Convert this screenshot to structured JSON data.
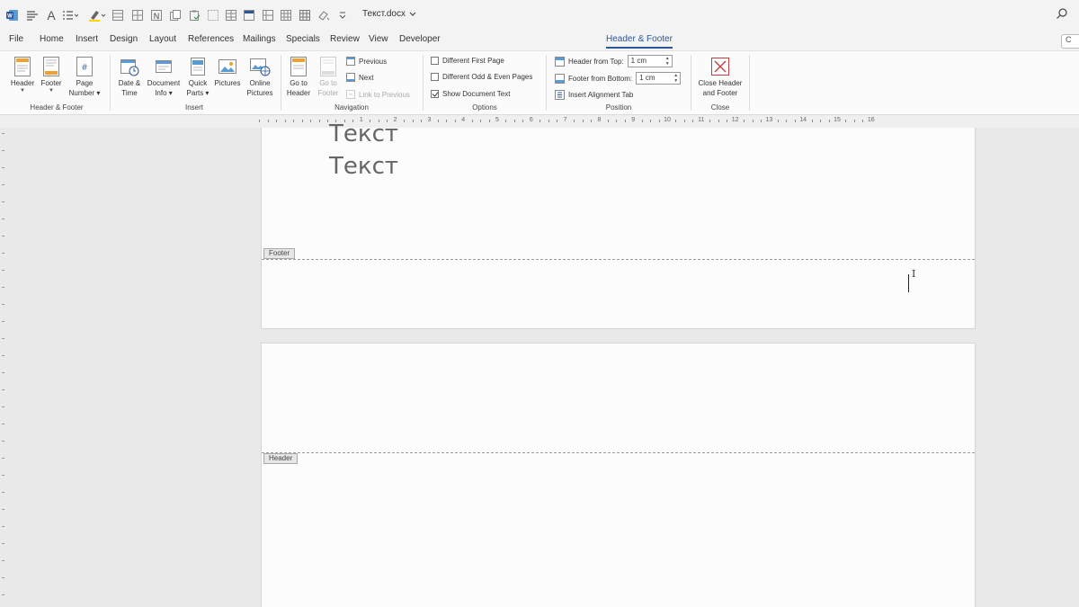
{
  "window": {
    "doc_title": "Текст.docx"
  },
  "tabs": [
    {
      "label": "File"
    },
    {
      "label": "Home"
    },
    {
      "label": "Insert"
    },
    {
      "label": "Design"
    },
    {
      "label": "Layout"
    },
    {
      "label": "References"
    },
    {
      "label": "Mailings"
    },
    {
      "label": "Specials"
    },
    {
      "label": "Review"
    },
    {
      "label": "View"
    },
    {
      "label": "Developer"
    },
    {
      "label": "Header & Footer",
      "active": true
    }
  ],
  "comment_button": "C",
  "ribbon": {
    "header_footer_group": {
      "label": "Header & Footer",
      "header": "Header",
      "footer": "Footer",
      "page_number_1": "Page",
      "page_number_2": "Number"
    },
    "insert_group": {
      "label": "Insert",
      "date_time_1": "Date &",
      "date_time_2": "Time",
      "document_info_1": "Document",
      "document_info_2": "Info",
      "quick_parts_1": "Quick",
      "quick_parts_2": "Parts",
      "pictures": "Pictures",
      "online_pictures_1": "Online",
      "online_pictures_2": "Pictures"
    },
    "navigation_group": {
      "label": "Navigation",
      "go_to_header_1": "Go to",
      "go_to_header_2": "Header",
      "go_to_footer_1": "Go to",
      "go_to_footer_2": "Footer",
      "previous": "Previous",
      "next": "Next",
      "link_to_previous": "Link to Previous"
    },
    "options_group": {
      "label": "Options",
      "different_first_page": "Different First Page",
      "different_odd_even": "Different Odd & Even Pages",
      "show_document_text": "Show Document Text"
    },
    "position_group": {
      "label": "Position",
      "header_from_top_label": "Header from Top:",
      "header_from_top_value": "1 cm",
      "footer_from_bottom_label": "Footer from Bottom:",
      "footer_from_bottom_value": "1 cm",
      "insert_alignment_tab": "Insert Alignment Tab"
    },
    "close_group": {
      "label": "Close",
      "close_1": "Close Header",
      "close_2": "and Footer"
    }
  },
  "ruler": {
    "numbers": [
      "1",
      "2",
      "3",
      "4",
      "5",
      "6",
      "7",
      "8",
      "9",
      "10",
      "11",
      "12",
      "13",
      "14",
      "15",
      "16"
    ]
  },
  "document": {
    "page1_line1": "Текст",
    "page1_line2": "Текст",
    "footer_tag": "Footer",
    "header_tag": "Header",
    "ibeam_glyph": "I"
  },
  "colors": {
    "accent": "#2b579a",
    "word_icon": "#2b579a",
    "close_icon": "#c43c3c"
  }
}
